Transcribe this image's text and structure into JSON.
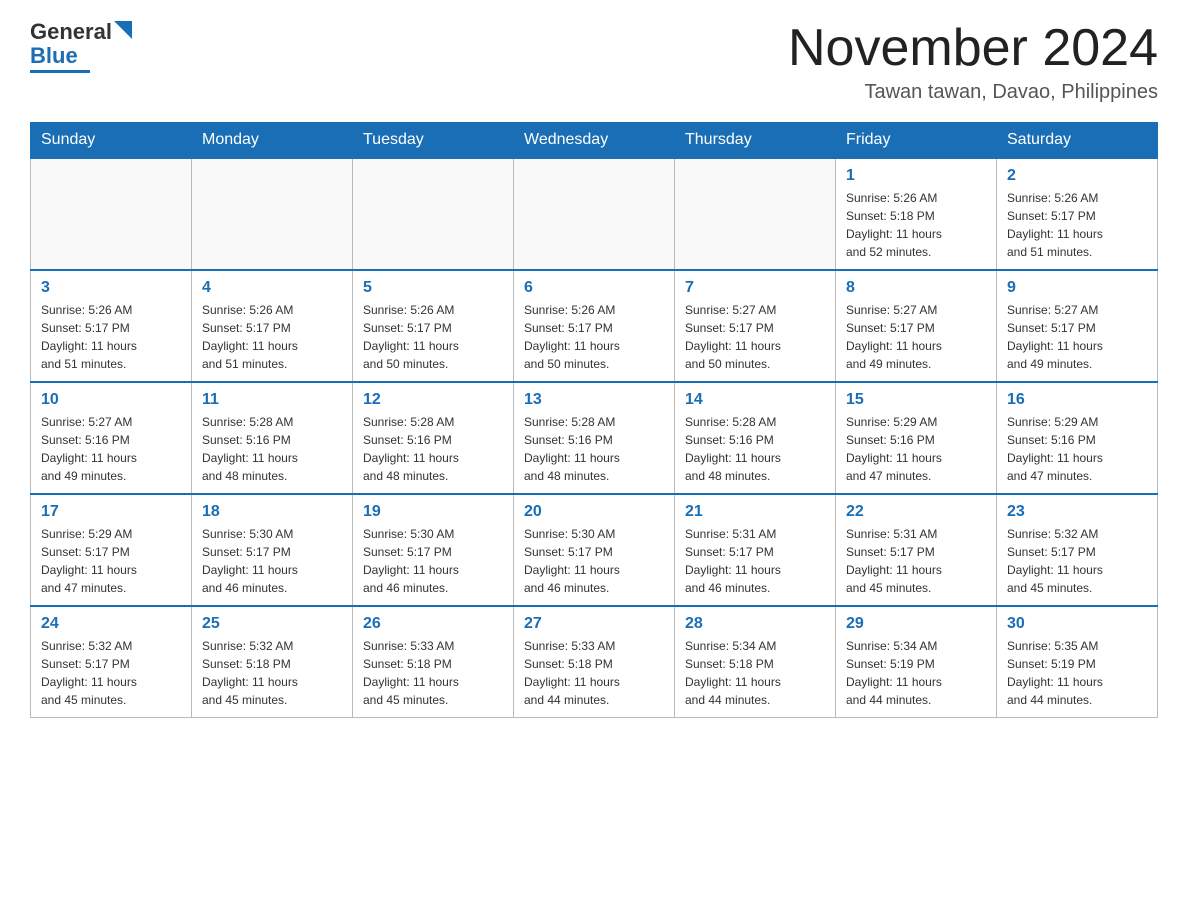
{
  "header": {
    "logo_general": "General",
    "logo_blue": "Blue",
    "main_title": "November 2024",
    "subtitle": "Tawan tawan, Davao, Philippines"
  },
  "weekdays": [
    "Sunday",
    "Monday",
    "Tuesday",
    "Wednesday",
    "Thursday",
    "Friday",
    "Saturday"
  ],
  "weeks": [
    [
      {
        "day": "",
        "info": ""
      },
      {
        "day": "",
        "info": ""
      },
      {
        "day": "",
        "info": ""
      },
      {
        "day": "",
        "info": ""
      },
      {
        "day": "",
        "info": ""
      },
      {
        "day": "1",
        "info": "Sunrise: 5:26 AM\nSunset: 5:18 PM\nDaylight: 11 hours\nand 52 minutes."
      },
      {
        "day": "2",
        "info": "Sunrise: 5:26 AM\nSunset: 5:17 PM\nDaylight: 11 hours\nand 51 minutes."
      }
    ],
    [
      {
        "day": "3",
        "info": "Sunrise: 5:26 AM\nSunset: 5:17 PM\nDaylight: 11 hours\nand 51 minutes."
      },
      {
        "day": "4",
        "info": "Sunrise: 5:26 AM\nSunset: 5:17 PM\nDaylight: 11 hours\nand 51 minutes."
      },
      {
        "day": "5",
        "info": "Sunrise: 5:26 AM\nSunset: 5:17 PM\nDaylight: 11 hours\nand 50 minutes."
      },
      {
        "day": "6",
        "info": "Sunrise: 5:26 AM\nSunset: 5:17 PM\nDaylight: 11 hours\nand 50 minutes."
      },
      {
        "day": "7",
        "info": "Sunrise: 5:27 AM\nSunset: 5:17 PM\nDaylight: 11 hours\nand 50 minutes."
      },
      {
        "day": "8",
        "info": "Sunrise: 5:27 AM\nSunset: 5:17 PM\nDaylight: 11 hours\nand 49 minutes."
      },
      {
        "day": "9",
        "info": "Sunrise: 5:27 AM\nSunset: 5:17 PM\nDaylight: 11 hours\nand 49 minutes."
      }
    ],
    [
      {
        "day": "10",
        "info": "Sunrise: 5:27 AM\nSunset: 5:16 PM\nDaylight: 11 hours\nand 49 minutes."
      },
      {
        "day": "11",
        "info": "Sunrise: 5:28 AM\nSunset: 5:16 PM\nDaylight: 11 hours\nand 48 minutes."
      },
      {
        "day": "12",
        "info": "Sunrise: 5:28 AM\nSunset: 5:16 PM\nDaylight: 11 hours\nand 48 minutes."
      },
      {
        "day": "13",
        "info": "Sunrise: 5:28 AM\nSunset: 5:16 PM\nDaylight: 11 hours\nand 48 minutes."
      },
      {
        "day": "14",
        "info": "Sunrise: 5:28 AM\nSunset: 5:16 PM\nDaylight: 11 hours\nand 48 minutes."
      },
      {
        "day": "15",
        "info": "Sunrise: 5:29 AM\nSunset: 5:16 PM\nDaylight: 11 hours\nand 47 minutes."
      },
      {
        "day": "16",
        "info": "Sunrise: 5:29 AM\nSunset: 5:16 PM\nDaylight: 11 hours\nand 47 minutes."
      }
    ],
    [
      {
        "day": "17",
        "info": "Sunrise: 5:29 AM\nSunset: 5:17 PM\nDaylight: 11 hours\nand 47 minutes."
      },
      {
        "day": "18",
        "info": "Sunrise: 5:30 AM\nSunset: 5:17 PM\nDaylight: 11 hours\nand 46 minutes."
      },
      {
        "day": "19",
        "info": "Sunrise: 5:30 AM\nSunset: 5:17 PM\nDaylight: 11 hours\nand 46 minutes."
      },
      {
        "day": "20",
        "info": "Sunrise: 5:30 AM\nSunset: 5:17 PM\nDaylight: 11 hours\nand 46 minutes."
      },
      {
        "day": "21",
        "info": "Sunrise: 5:31 AM\nSunset: 5:17 PM\nDaylight: 11 hours\nand 46 minutes."
      },
      {
        "day": "22",
        "info": "Sunrise: 5:31 AM\nSunset: 5:17 PM\nDaylight: 11 hours\nand 45 minutes."
      },
      {
        "day": "23",
        "info": "Sunrise: 5:32 AM\nSunset: 5:17 PM\nDaylight: 11 hours\nand 45 minutes."
      }
    ],
    [
      {
        "day": "24",
        "info": "Sunrise: 5:32 AM\nSunset: 5:17 PM\nDaylight: 11 hours\nand 45 minutes."
      },
      {
        "day": "25",
        "info": "Sunrise: 5:32 AM\nSunset: 5:18 PM\nDaylight: 11 hours\nand 45 minutes."
      },
      {
        "day": "26",
        "info": "Sunrise: 5:33 AM\nSunset: 5:18 PM\nDaylight: 11 hours\nand 45 minutes."
      },
      {
        "day": "27",
        "info": "Sunrise: 5:33 AM\nSunset: 5:18 PM\nDaylight: 11 hours\nand 44 minutes."
      },
      {
        "day": "28",
        "info": "Sunrise: 5:34 AM\nSunset: 5:18 PM\nDaylight: 11 hours\nand 44 minutes."
      },
      {
        "day": "29",
        "info": "Sunrise: 5:34 AM\nSunset: 5:19 PM\nDaylight: 11 hours\nand 44 minutes."
      },
      {
        "day": "30",
        "info": "Sunrise: 5:35 AM\nSunset: 5:19 PM\nDaylight: 11 hours\nand 44 minutes."
      }
    ]
  ]
}
